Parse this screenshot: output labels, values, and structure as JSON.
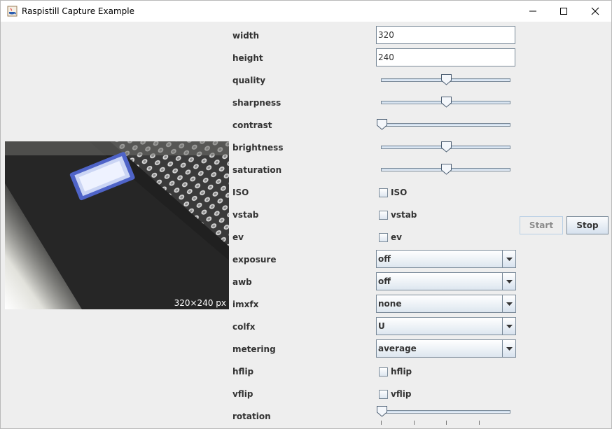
{
  "window": {
    "title": "Raspistill Capture Example",
    "controls": {
      "minimize": "minimize-icon",
      "maximize": "maximize-icon",
      "close": "close-icon"
    }
  },
  "preview": {
    "caption": "320×240 px"
  },
  "fields": {
    "width": {
      "label": "width",
      "value": "320"
    },
    "height": {
      "label": "height",
      "value": "240"
    }
  },
  "sliders": {
    "quality": {
      "label": "quality",
      "level": 0.5
    },
    "sharpness": {
      "label": "sharpness",
      "level": 0.5
    },
    "contrast": {
      "label": "contrast",
      "level": 0.0
    },
    "brightness": {
      "label": "brightness",
      "level": 0.5
    },
    "saturation": {
      "label": "saturation",
      "level": 0.5
    },
    "rotation": {
      "label": "rotation",
      "level": 0.0
    }
  },
  "checks": {
    "iso": {
      "label": "ISO",
      "text": "ISO",
      "checked": false
    },
    "vstab": {
      "label": "vstab",
      "text": "vstab",
      "checked": false
    },
    "ev": {
      "label": "ev",
      "text": "ev",
      "checked": false
    },
    "hflip": {
      "label": "hflip",
      "text": "hflip",
      "checked": false
    },
    "vflip": {
      "label": "vflip",
      "text": "vflip",
      "checked": false
    }
  },
  "combos": {
    "exposure": {
      "label": "exposure",
      "value": "off"
    },
    "awb": {
      "label": "awb",
      "value": "off"
    },
    "imxfx": {
      "label": "imxfx",
      "value": "none"
    },
    "colfx": {
      "label": "colfx",
      "value": "U"
    },
    "metering": {
      "label": "metering",
      "value": "average"
    }
  },
  "buttons": {
    "start": "Start",
    "stop": "Stop"
  }
}
